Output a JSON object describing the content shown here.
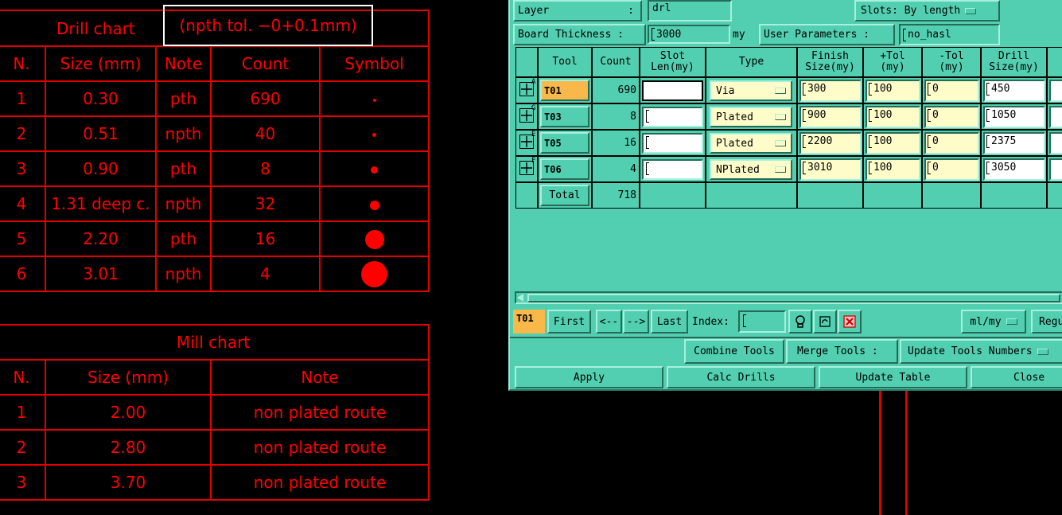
{
  "drill_chart": {
    "title": "Drill chart",
    "tolerance": "(npth tol. −0+0.1mm)",
    "headers": [
      "N.",
      "Size (mm)",
      "Note",
      "Count",
      "Symbol"
    ],
    "rows": [
      {
        "n": "1",
        "size": "0.30",
        "note": "pth",
        "count": "690",
        "symbol_dot": 4
      },
      {
        "n": "2",
        "size": "0.51",
        "note": "npth",
        "count": "40",
        "symbol_dot": 5
      },
      {
        "n": "3",
        "size": "0.90",
        "note": "pth",
        "count": "8",
        "symbol_dot": 9
      },
      {
        "n": "4",
        "size": "1.31 deep c.",
        "note": "npth",
        "count": "32",
        "symbol_dot": 12
      },
      {
        "n": "5",
        "size": "2.20",
        "note": "pth",
        "count": "16",
        "symbol_dot": 24
      },
      {
        "n": "6",
        "size": "3.01",
        "note": "npth",
        "count": "4",
        "symbol_dot": 33
      }
    ]
  },
  "mill_chart": {
    "title": "Mill chart",
    "headers": [
      "N.",
      "Size (mm)",
      "Note"
    ],
    "rows": [
      {
        "n": "1",
        "size": "2.00",
        "note": "non plated route"
      },
      {
        "n": "2",
        "size": "2.80",
        "note": "non plated route"
      },
      {
        "n": "3",
        "size": "3.70",
        "note": "non plated route"
      }
    ]
  },
  "dialog": {
    "layer_label": "Layer",
    "layer_colon": ":",
    "layer_value": "drl",
    "slots_label": "Slots:",
    "slots_value": "By length",
    "board_thickness_label": "Board Thickness :",
    "board_thickness_value": "3000",
    "board_thickness_unit": "my",
    "user_params_label": "User Parameters :",
    "user_params_value": "no_hasl",
    "columns": [
      "Tool",
      "Count",
      "Slot\nLen(my)",
      "Type",
      "Finish\nSize(my)",
      "+Tol\n(my)",
      "-Tol\n(my)",
      "Drill\nSize(my)"
    ],
    "rows": [
      {
        "ptr": "A",
        "tool": "T01",
        "count": "690",
        "slot": "",
        "type": "Via",
        "finish": "300",
        "ptol": "100",
        "ntol": "0",
        "drill": "450"
      },
      {
        "ptr": "G",
        "tool": "T03",
        "count": "8",
        "slot": "",
        "type": "Plated",
        "finish": "900",
        "ptol": "100",
        "ntol": "0",
        "drill": "1050"
      },
      {
        "ptr": "E",
        "tool": "T05",
        "count": "16",
        "slot": "",
        "type": "Plated",
        "finish": "2200",
        "ptol": "100",
        "ntol": "0",
        "drill": "2375"
      },
      {
        "ptr": "F",
        "tool": "T06",
        "count": "4",
        "slot": "",
        "type": "NPlated",
        "finish": "3010",
        "ptol": "100",
        "ntol": "0",
        "drill": "3050"
      }
    ],
    "total_label": "Total",
    "total_count": "718",
    "current_tool": "T01",
    "nav": {
      "first": "First",
      "prev": "<--",
      "next": "-->",
      "last": "Last",
      "index_label": "Index:"
    },
    "units_value": "ml/my",
    "regu_label": "Regu",
    "combine_tools": "Combine Tools",
    "merge_tools_label": "Merge Tools :",
    "merge_tools_value": "Update Tools Numbers",
    "apply": "Apply",
    "calc_drills": "Calc Drills",
    "update_table": "Update Table",
    "close": "Close"
  }
}
